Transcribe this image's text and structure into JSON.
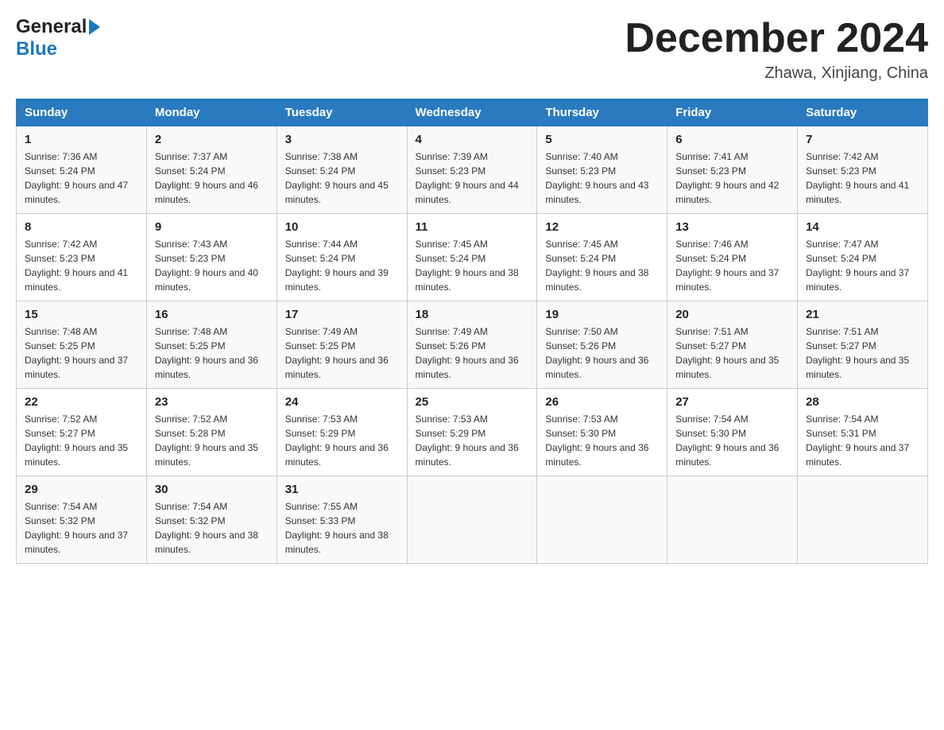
{
  "header": {
    "logo_general": "General",
    "logo_blue": "Blue",
    "title": "December 2024",
    "subtitle": "Zhawa, Xinjiang, China"
  },
  "days_of_week": [
    "Sunday",
    "Monday",
    "Tuesday",
    "Wednesday",
    "Thursday",
    "Friday",
    "Saturday"
  ],
  "weeks": [
    [
      {
        "day": "1",
        "sunrise": "7:36 AM",
        "sunset": "5:24 PM",
        "daylight": "9 hours and 47 minutes."
      },
      {
        "day": "2",
        "sunrise": "7:37 AM",
        "sunset": "5:24 PM",
        "daylight": "9 hours and 46 minutes."
      },
      {
        "day": "3",
        "sunrise": "7:38 AM",
        "sunset": "5:24 PM",
        "daylight": "9 hours and 45 minutes."
      },
      {
        "day": "4",
        "sunrise": "7:39 AM",
        "sunset": "5:23 PM",
        "daylight": "9 hours and 44 minutes."
      },
      {
        "day": "5",
        "sunrise": "7:40 AM",
        "sunset": "5:23 PM",
        "daylight": "9 hours and 43 minutes."
      },
      {
        "day": "6",
        "sunrise": "7:41 AM",
        "sunset": "5:23 PM",
        "daylight": "9 hours and 42 minutes."
      },
      {
        "day": "7",
        "sunrise": "7:42 AM",
        "sunset": "5:23 PM",
        "daylight": "9 hours and 41 minutes."
      }
    ],
    [
      {
        "day": "8",
        "sunrise": "7:42 AM",
        "sunset": "5:23 PM",
        "daylight": "9 hours and 41 minutes."
      },
      {
        "day": "9",
        "sunrise": "7:43 AM",
        "sunset": "5:23 PM",
        "daylight": "9 hours and 40 minutes."
      },
      {
        "day": "10",
        "sunrise": "7:44 AM",
        "sunset": "5:24 PM",
        "daylight": "9 hours and 39 minutes."
      },
      {
        "day": "11",
        "sunrise": "7:45 AM",
        "sunset": "5:24 PM",
        "daylight": "9 hours and 38 minutes."
      },
      {
        "day": "12",
        "sunrise": "7:45 AM",
        "sunset": "5:24 PM",
        "daylight": "9 hours and 38 minutes."
      },
      {
        "day": "13",
        "sunrise": "7:46 AM",
        "sunset": "5:24 PM",
        "daylight": "9 hours and 37 minutes."
      },
      {
        "day": "14",
        "sunrise": "7:47 AM",
        "sunset": "5:24 PM",
        "daylight": "9 hours and 37 minutes."
      }
    ],
    [
      {
        "day": "15",
        "sunrise": "7:48 AM",
        "sunset": "5:25 PM",
        "daylight": "9 hours and 37 minutes."
      },
      {
        "day": "16",
        "sunrise": "7:48 AM",
        "sunset": "5:25 PM",
        "daylight": "9 hours and 36 minutes."
      },
      {
        "day": "17",
        "sunrise": "7:49 AM",
        "sunset": "5:25 PM",
        "daylight": "9 hours and 36 minutes."
      },
      {
        "day": "18",
        "sunrise": "7:49 AM",
        "sunset": "5:26 PM",
        "daylight": "9 hours and 36 minutes."
      },
      {
        "day": "19",
        "sunrise": "7:50 AM",
        "sunset": "5:26 PM",
        "daylight": "9 hours and 36 minutes."
      },
      {
        "day": "20",
        "sunrise": "7:51 AM",
        "sunset": "5:27 PM",
        "daylight": "9 hours and 35 minutes."
      },
      {
        "day": "21",
        "sunrise": "7:51 AM",
        "sunset": "5:27 PM",
        "daylight": "9 hours and 35 minutes."
      }
    ],
    [
      {
        "day": "22",
        "sunrise": "7:52 AM",
        "sunset": "5:27 PM",
        "daylight": "9 hours and 35 minutes."
      },
      {
        "day": "23",
        "sunrise": "7:52 AM",
        "sunset": "5:28 PM",
        "daylight": "9 hours and 35 minutes."
      },
      {
        "day": "24",
        "sunrise": "7:53 AM",
        "sunset": "5:29 PM",
        "daylight": "9 hours and 36 minutes."
      },
      {
        "day": "25",
        "sunrise": "7:53 AM",
        "sunset": "5:29 PM",
        "daylight": "9 hours and 36 minutes."
      },
      {
        "day": "26",
        "sunrise": "7:53 AM",
        "sunset": "5:30 PM",
        "daylight": "9 hours and 36 minutes."
      },
      {
        "day": "27",
        "sunrise": "7:54 AM",
        "sunset": "5:30 PM",
        "daylight": "9 hours and 36 minutes."
      },
      {
        "day": "28",
        "sunrise": "7:54 AM",
        "sunset": "5:31 PM",
        "daylight": "9 hours and 37 minutes."
      }
    ],
    [
      {
        "day": "29",
        "sunrise": "7:54 AM",
        "sunset": "5:32 PM",
        "daylight": "9 hours and 37 minutes."
      },
      {
        "day": "30",
        "sunrise": "7:54 AM",
        "sunset": "5:32 PM",
        "daylight": "9 hours and 38 minutes."
      },
      {
        "day": "31",
        "sunrise": "7:55 AM",
        "sunset": "5:33 PM",
        "daylight": "9 hours and 38 minutes."
      },
      null,
      null,
      null,
      null
    ]
  ]
}
